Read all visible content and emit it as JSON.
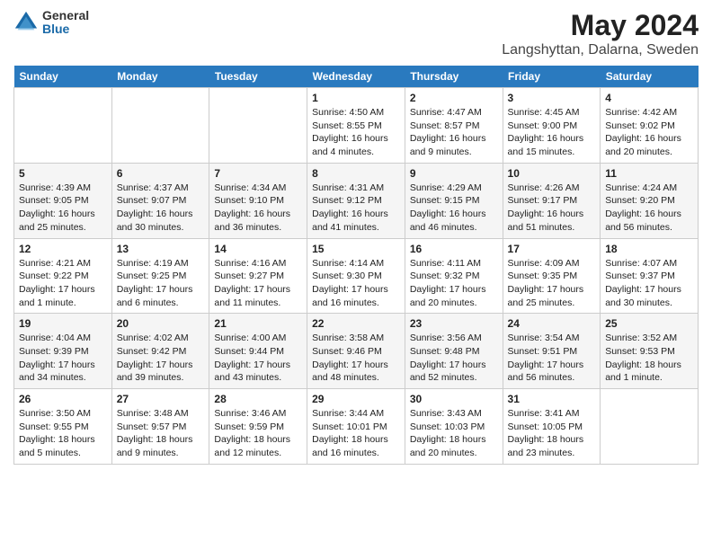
{
  "header": {
    "logo_general": "General",
    "logo_blue": "Blue",
    "month_year": "May 2024",
    "location": "Langshyttan, Dalarna, Sweden"
  },
  "weekdays": [
    "Sunday",
    "Monday",
    "Tuesday",
    "Wednesday",
    "Thursday",
    "Friday",
    "Saturday"
  ],
  "weeks": [
    [
      {
        "day": "",
        "info": ""
      },
      {
        "day": "",
        "info": ""
      },
      {
        "day": "",
        "info": ""
      },
      {
        "day": "1",
        "info": "Sunrise: 4:50 AM\nSunset: 8:55 PM\nDaylight: 16 hours\nand 4 minutes."
      },
      {
        "day": "2",
        "info": "Sunrise: 4:47 AM\nSunset: 8:57 PM\nDaylight: 16 hours\nand 9 minutes."
      },
      {
        "day": "3",
        "info": "Sunrise: 4:45 AM\nSunset: 9:00 PM\nDaylight: 16 hours\nand 15 minutes."
      },
      {
        "day": "4",
        "info": "Sunrise: 4:42 AM\nSunset: 9:02 PM\nDaylight: 16 hours\nand 20 minutes."
      }
    ],
    [
      {
        "day": "5",
        "info": "Sunrise: 4:39 AM\nSunset: 9:05 PM\nDaylight: 16 hours\nand 25 minutes."
      },
      {
        "day": "6",
        "info": "Sunrise: 4:37 AM\nSunset: 9:07 PM\nDaylight: 16 hours\nand 30 minutes."
      },
      {
        "day": "7",
        "info": "Sunrise: 4:34 AM\nSunset: 9:10 PM\nDaylight: 16 hours\nand 36 minutes."
      },
      {
        "day": "8",
        "info": "Sunrise: 4:31 AM\nSunset: 9:12 PM\nDaylight: 16 hours\nand 41 minutes."
      },
      {
        "day": "9",
        "info": "Sunrise: 4:29 AM\nSunset: 9:15 PM\nDaylight: 16 hours\nand 46 minutes."
      },
      {
        "day": "10",
        "info": "Sunrise: 4:26 AM\nSunset: 9:17 PM\nDaylight: 16 hours\nand 51 minutes."
      },
      {
        "day": "11",
        "info": "Sunrise: 4:24 AM\nSunset: 9:20 PM\nDaylight: 16 hours\nand 56 minutes."
      }
    ],
    [
      {
        "day": "12",
        "info": "Sunrise: 4:21 AM\nSunset: 9:22 PM\nDaylight: 17 hours\nand 1 minute."
      },
      {
        "day": "13",
        "info": "Sunrise: 4:19 AM\nSunset: 9:25 PM\nDaylight: 17 hours\nand 6 minutes."
      },
      {
        "day": "14",
        "info": "Sunrise: 4:16 AM\nSunset: 9:27 PM\nDaylight: 17 hours\nand 11 minutes."
      },
      {
        "day": "15",
        "info": "Sunrise: 4:14 AM\nSunset: 9:30 PM\nDaylight: 17 hours\nand 16 minutes."
      },
      {
        "day": "16",
        "info": "Sunrise: 4:11 AM\nSunset: 9:32 PM\nDaylight: 17 hours\nand 20 minutes."
      },
      {
        "day": "17",
        "info": "Sunrise: 4:09 AM\nSunset: 9:35 PM\nDaylight: 17 hours\nand 25 minutes."
      },
      {
        "day": "18",
        "info": "Sunrise: 4:07 AM\nSunset: 9:37 PM\nDaylight: 17 hours\nand 30 minutes."
      }
    ],
    [
      {
        "day": "19",
        "info": "Sunrise: 4:04 AM\nSunset: 9:39 PM\nDaylight: 17 hours\nand 34 minutes."
      },
      {
        "day": "20",
        "info": "Sunrise: 4:02 AM\nSunset: 9:42 PM\nDaylight: 17 hours\nand 39 minutes."
      },
      {
        "day": "21",
        "info": "Sunrise: 4:00 AM\nSunset: 9:44 PM\nDaylight: 17 hours\nand 43 minutes."
      },
      {
        "day": "22",
        "info": "Sunrise: 3:58 AM\nSunset: 9:46 PM\nDaylight: 17 hours\nand 48 minutes."
      },
      {
        "day": "23",
        "info": "Sunrise: 3:56 AM\nSunset: 9:48 PM\nDaylight: 17 hours\nand 52 minutes."
      },
      {
        "day": "24",
        "info": "Sunrise: 3:54 AM\nSunset: 9:51 PM\nDaylight: 17 hours\nand 56 minutes."
      },
      {
        "day": "25",
        "info": "Sunrise: 3:52 AM\nSunset: 9:53 PM\nDaylight: 18 hours\nand 1 minute."
      }
    ],
    [
      {
        "day": "26",
        "info": "Sunrise: 3:50 AM\nSunset: 9:55 PM\nDaylight: 18 hours\nand 5 minutes."
      },
      {
        "day": "27",
        "info": "Sunrise: 3:48 AM\nSunset: 9:57 PM\nDaylight: 18 hours\nand 9 minutes."
      },
      {
        "day": "28",
        "info": "Sunrise: 3:46 AM\nSunset: 9:59 PM\nDaylight: 18 hours\nand 12 minutes."
      },
      {
        "day": "29",
        "info": "Sunrise: 3:44 AM\nSunset: 10:01 PM\nDaylight: 18 hours\nand 16 minutes."
      },
      {
        "day": "30",
        "info": "Sunrise: 3:43 AM\nSunset: 10:03 PM\nDaylight: 18 hours\nand 20 minutes."
      },
      {
        "day": "31",
        "info": "Sunrise: 3:41 AM\nSunset: 10:05 PM\nDaylight: 18 hours\nand 23 minutes."
      },
      {
        "day": "",
        "info": ""
      }
    ]
  ]
}
